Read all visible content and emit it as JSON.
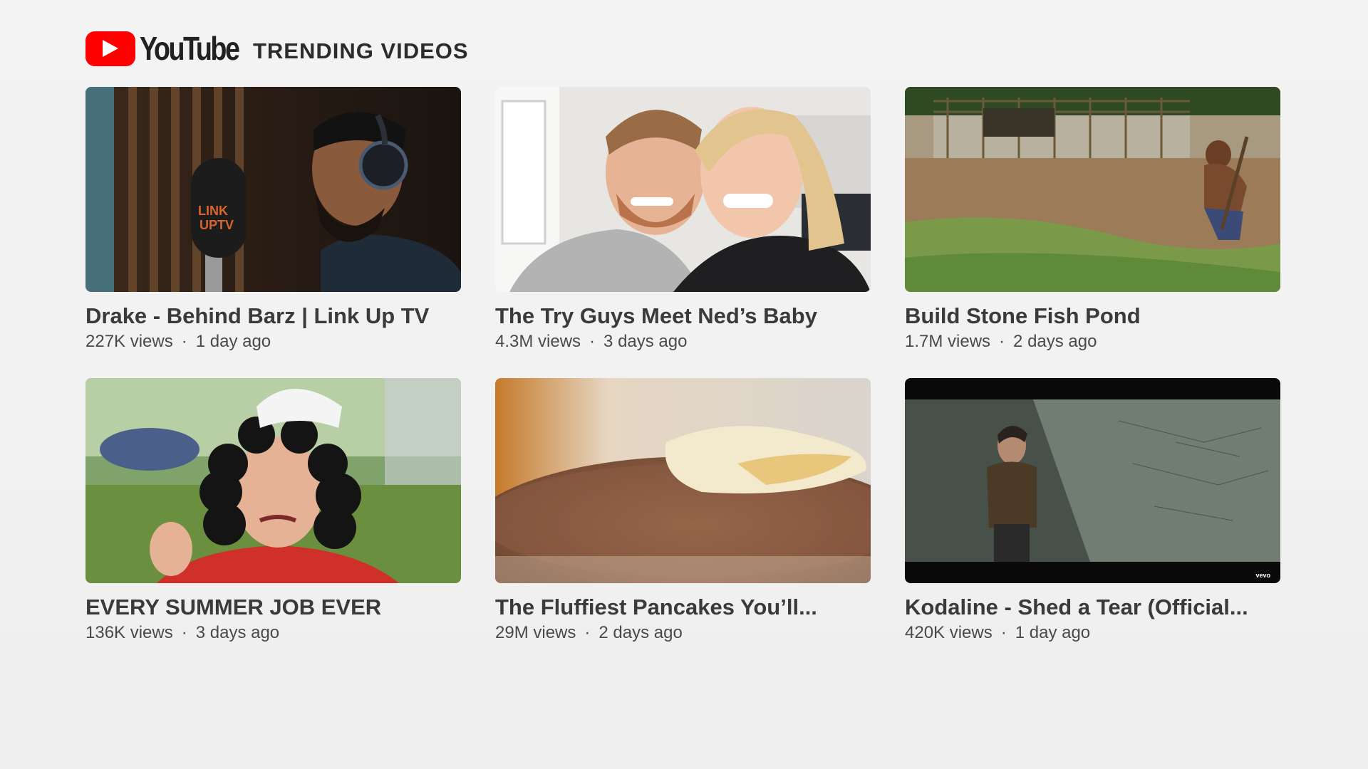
{
  "header": {
    "logo_text": "YouTube",
    "section_title": "TRENDING VIDEOS"
  },
  "colors": {
    "brand_red": "#FF0000",
    "background": "#F2F2F2",
    "title_text": "#3A3A3A",
    "meta_text": "#4A4A4A"
  },
  "videos": [
    {
      "title": "Drake - Behind Barz | Link Up TV",
      "views": "227K views",
      "age": "1 day ago",
      "thumbnail": "studio-singer-microphone"
    },
    {
      "title": "The Try Guys Meet Ned’s Baby",
      "views": "4.3M views",
      "age": "3 days ago",
      "thumbnail": "couple-selfie"
    },
    {
      "title": "Build Stone Fish Pond",
      "views": "1.7M views",
      "age": "2 days ago",
      "thumbnail": "man-digging-field"
    },
    {
      "title": "EVERY SUMMER JOB EVER",
      "views": "136K views",
      "age": "3 days ago",
      "thumbnail": "curly-wig-cap"
    },
    {
      "title": "The Fluffiest Pancakes You’ll...",
      "views": "29M views",
      "age": "2 days ago",
      "thumbnail": "pancake-closeup"
    },
    {
      "title": "Kodaline - Shed a Tear (Official...",
      "views": "420K views",
      "age": "1 day ago",
      "thumbnail": "man-concrete-wall",
      "watermark": "vevo"
    }
  ],
  "meta_separator": "·"
}
